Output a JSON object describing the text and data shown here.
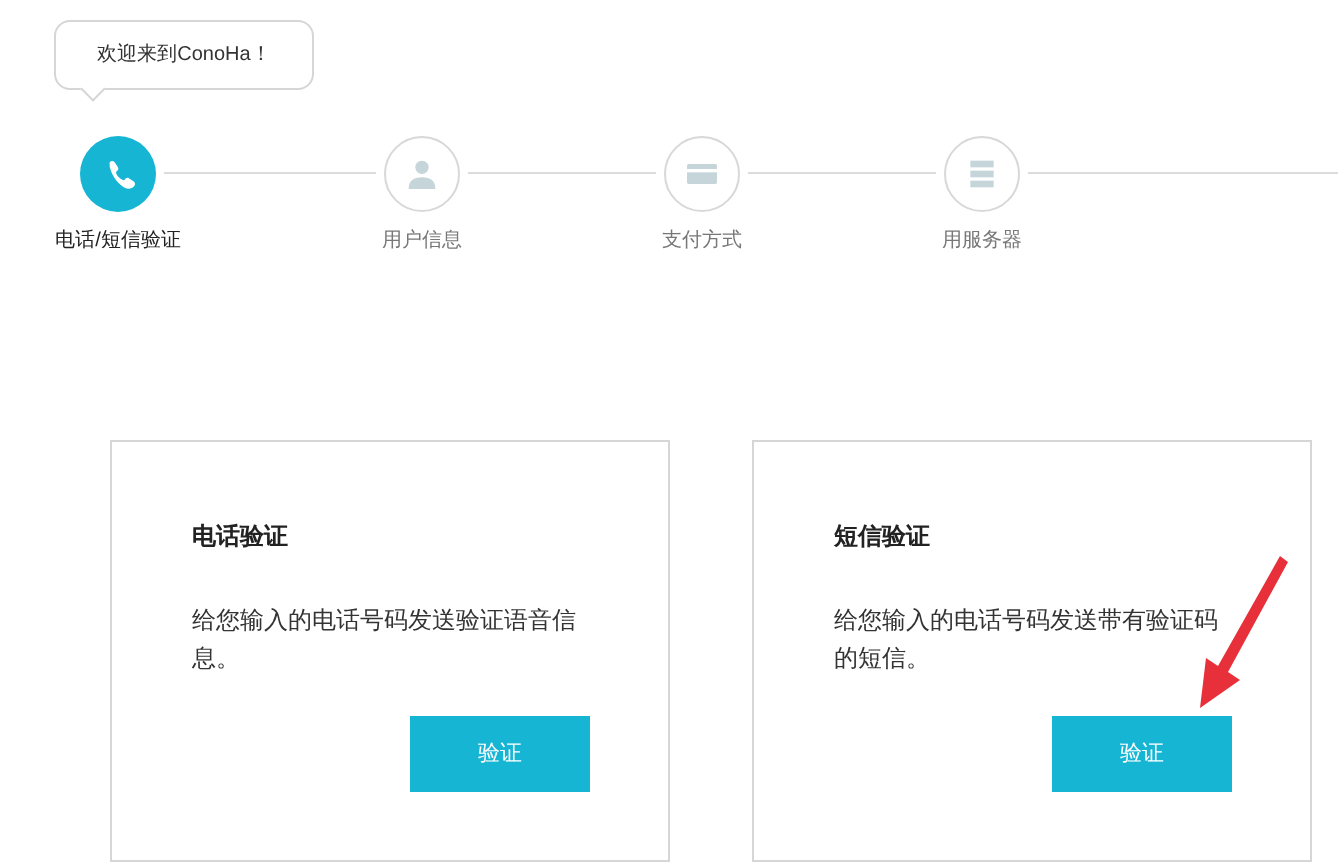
{
  "tooltip": {
    "text": "欢迎来到ConoHa！"
  },
  "steps": [
    {
      "label": "电话/短信验证",
      "selected": true
    },
    {
      "label": "用户信息",
      "selected": false
    },
    {
      "label": "支付方式",
      "selected": false
    },
    {
      "label": "用服务器",
      "selected": false
    }
  ],
  "cards": [
    {
      "title": "电话验证",
      "description": "给您输入的电话号码发送验证语音信息。",
      "button": "验证"
    },
    {
      "title": "短信验证",
      "description": "给您输入的电话号码发送带有验证码的短信。",
      "button": "验证"
    }
  ]
}
